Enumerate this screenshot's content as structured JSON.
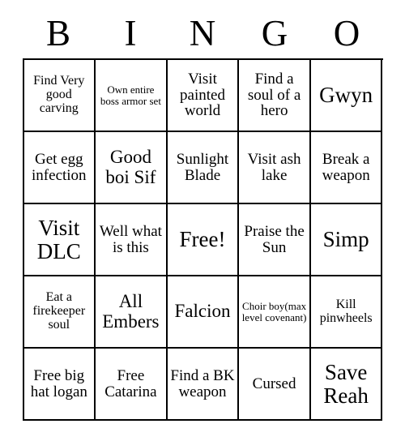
{
  "header": {
    "letters": [
      "B",
      "I",
      "N",
      "G",
      "O"
    ]
  },
  "grid": {
    "rows": [
      [
        {
          "text": "Find Very good carving",
          "size": "fs-s"
        },
        {
          "text": "Own entire boss armor set",
          "size": "fs-xs"
        },
        {
          "text": "Visit painted world",
          "size": "fs-m"
        },
        {
          "text": "Find a soul of a hero",
          "size": "fs-m"
        },
        {
          "text": "Gwyn",
          "size": "fs-xl"
        }
      ],
      [
        {
          "text": "Get egg infection",
          "size": "fs-m"
        },
        {
          "text": "Good boi Sif",
          "size": "fs-l"
        },
        {
          "text": "Sunlight Blade",
          "size": "fs-m"
        },
        {
          "text": "Visit ash lake",
          "size": "fs-m"
        },
        {
          "text": "Break a weapon",
          "size": "fs-m"
        }
      ],
      [
        {
          "text": "Visit DLC",
          "size": "fs-xl"
        },
        {
          "text": "Well what is this",
          "size": "fs-m"
        },
        {
          "text": "Free!",
          "size": "fs-xl"
        },
        {
          "text": "Praise the Sun",
          "size": "fs-m"
        },
        {
          "text": "Simp",
          "size": "fs-xl"
        }
      ],
      [
        {
          "text": "Eat a firekeeper soul",
          "size": "fs-s"
        },
        {
          "text": "All Embers",
          "size": "fs-l"
        },
        {
          "text": "Falcion",
          "size": "fs-l"
        },
        {
          "text": "Choir boy(max level covenant)",
          "size": "fs-xs"
        },
        {
          "text": "Kill pinwheels",
          "size": "fs-s"
        }
      ],
      [
        {
          "text": "Free big hat logan",
          "size": "fs-m"
        },
        {
          "text": "Free Catarina",
          "size": "fs-m"
        },
        {
          "text": "Find a BK weapon",
          "size": "fs-m"
        },
        {
          "text": "Cursed",
          "size": "fs-m"
        },
        {
          "text": "Save Reah",
          "size": "fs-xl"
        }
      ]
    ]
  }
}
